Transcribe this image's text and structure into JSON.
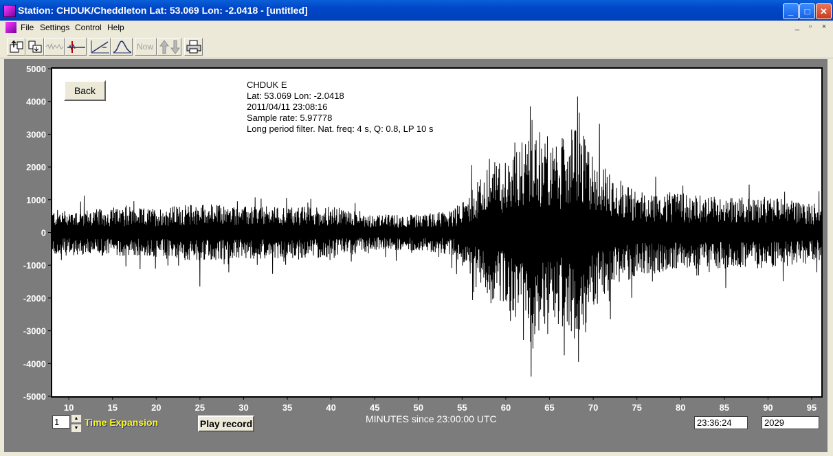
{
  "window": {
    "title": "Station: CHDUK/Cheddleton Lat: 53.069 Lon: -2.0418 - [untitled]",
    "minimize_icon": "minimize-icon",
    "maximize_icon": "maximize-icon",
    "close_icon": "close-icon"
  },
  "menu": {
    "items": [
      "File",
      "Settings",
      "Control",
      "Help"
    ],
    "mdi_controls": [
      "_",
      "▫",
      "×"
    ]
  },
  "toolbar": {
    "buttons": [
      {
        "icon": "open-record-icon"
      },
      {
        "icon": "save-record-icon"
      },
      {
        "icon": "waveform-icon"
      },
      {
        "icon": "pick-marker-icon"
      },
      {
        "icon": "spectrum-icon"
      },
      {
        "icon": "filter-response-icon"
      },
      {
        "icon": "now-button",
        "label": "Now"
      },
      {
        "icon": "up-down-arrows-icon"
      },
      {
        "icon": "printer-icon"
      }
    ]
  },
  "plot": {
    "back_label": "Back",
    "info_lines": [
      "CHDUK  E",
      "Lat: 53.069 Lon: -2.0418",
      "2011/04/11 23:08:16",
      "Sample rate: 5.97778",
      "Long period filter. Nat. freq: 4 s, Q: 0.8, LP 10 s"
    ],
    "x_caption": "MINUTES since 23:00:00 UTC",
    "time_expansion_label": "Time Expansion",
    "time_expansion_value": "1",
    "play_label": "Play record",
    "time_readout": "23:36:24",
    "count_readout": "2029"
  },
  "chart_data": {
    "type": "line",
    "title": "",
    "xlabel": "MINUTES since 23:00:00 UTC",
    "ylabel": "",
    "xlim": [
      8.1,
      96.1
    ],
    "ylim": [
      -5000,
      5000
    ],
    "xticks": [
      10,
      15,
      20,
      25,
      30,
      35,
      40,
      45,
      50,
      55,
      60,
      65,
      70,
      75,
      80,
      85,
      90,
      95
    ],
    "yticks": [
      5000,
      4000,
      3000,
      2000,
      1000,
      0,
      -1000,
      -2000,
      -3000,
      -4000,
      -5000
    ],
    "grid": false,
    "series": [
      {
        "color": "#000000",
        "envelope": {
          "x": [
            8.1,
            20,
            25,
            30,
            40,
            45,
            50,
            54,
            56,
            58,
            60,
            62,
            63,
            65,
            67,
            68,
            70,
            72,
            75,
            80,
            85,
            90,
            96.1
          ],
          "amplitude": [
            700,
            750,
            900,
            800,
            800,
            550,
            550,
            700,
            1300,
            2000,
            2300,
            2900,
            3600,
            2600,
            3000,
            3400,
            2400,
            1800,
            1300,
            1200,
            1100,
            1100,
            900
          ]
        },
        "notable_peaks": [
          {
            "x": 62.8,
            "y": 3850
          },
          {
            "x": 62.9,
            "y": -4400
          },
          {
            "x": 66.6,
            "y": 2850
          },
          {
            "x": 66.7,
            "y": -3750
          },
          {
            "x": 68.2,
            "y": 4150
          },
          {
            "x": 68.3,
            "y": -3950
          },
          {
            "x": 72.0,
            "y": -2650
          },
          {
            "x": 60.5,
            "y": -2700
          },
          {
            "x": 64.8,
            "y": -3100
          },
          {
            "x": 25.0,
            "y": -1650
          }
        ]
      }
    ]
  }
}
